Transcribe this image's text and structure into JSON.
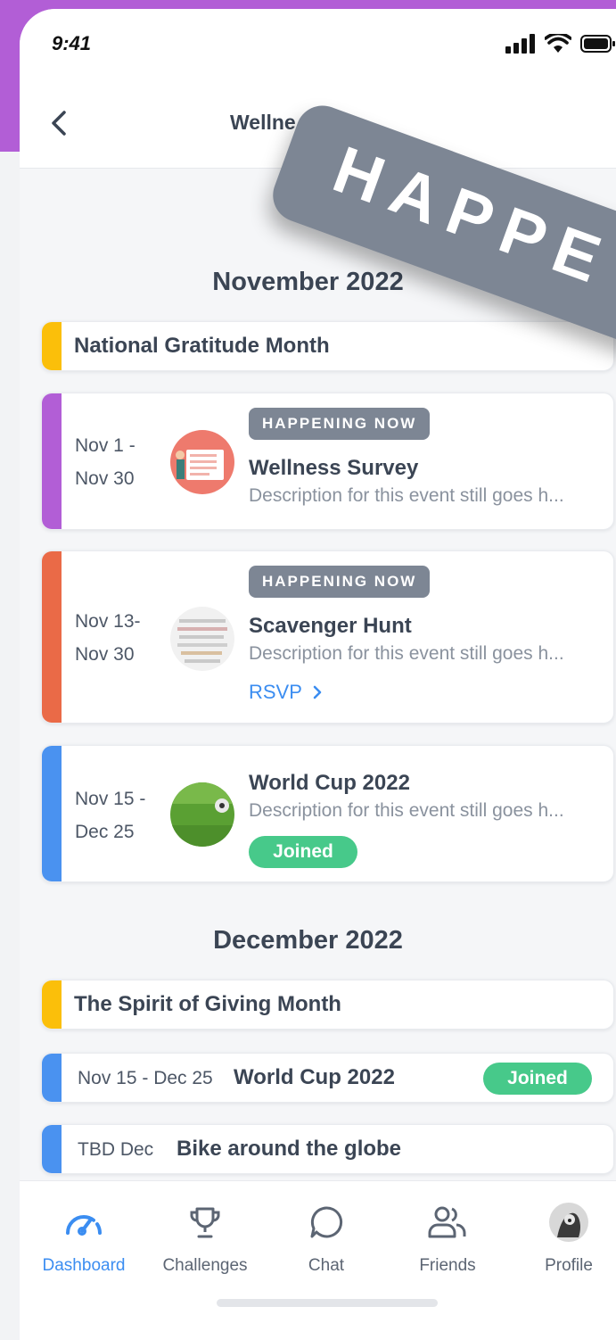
{
  "status_bar": {
    "time": "9:41"
  },
  "header": {
    "title": "Wellne",
    "overlay_badge": "HAPPE"
  },
  "sections": [
    {
      "month": "November 2022",
      "observance": {
        "title": "National Gratitude Month",
        "color": "#fbbf0a"
      },
      "events": [
        {
          "date_line1": "Nov 1 -",
          "date_line2": "Nov 30",
          "badge": "HAPPENING NOW",
          "title": "Wellness Survey",
          "description": "Description for this event still goes h...",
          "color": "#b25ed6"
        },
        {
          "date_line1": "Nov 13-",
          "date_line2": "Nov 30",
          "badge": "HAPPENING NOW",
          "title": "Scavenger Hunt",
          "description": "Description for this event still goes h...",
          "action": "RSVP",
          "color": "#ea6a47"
        },
        {
          "date_line1": "Nov 15 -",
          "date_line2": "Dec 25",
          "title": "World Cup 2022",
          "description": "Description for this event still goes h...",
          "status": "Joined",
          "color": "#4a92f0"
        }
      ]
    },
    {
      "month": "December 2022",
      "observance": {
        "title": "The Spirit of Giving Month",
        "color": "#fbbf0a"
      },
      "events": [
        {
          "date": "Nov 15 - Dec 25",
          "title": "World Cup 2022",
          "status": "Joined",
          "color": "#4a92f0"
        },
        {
          "date": "TBD Dec",
          "title": "Bike around the globe",
          "color": "#4a92f0"
        }
      ]
    }
  ],
  "tabbar": {
    "items": [
      {
        "label": "Dashboard",
        "icon": "gauge-icon",
        "active": true
      },
      {
        "label": "Challenges",
        "icon": "trophy-icon"
      },
      {
        "label": "Chat",
        "icon": "chat-bubble-icon"
      },
      {
        "label": "Friends",
        "icon": "friends-icon"
      },
      {
        "label": "Profile",
        "icon": "avatar"
      }
    ]
  },
  "colors": {
    "accent": "#3b8df1",
    "joined": "#47c98a",
    "badge": "#7d8694",
    "header_bg": "#b25ed6"
  }
}
